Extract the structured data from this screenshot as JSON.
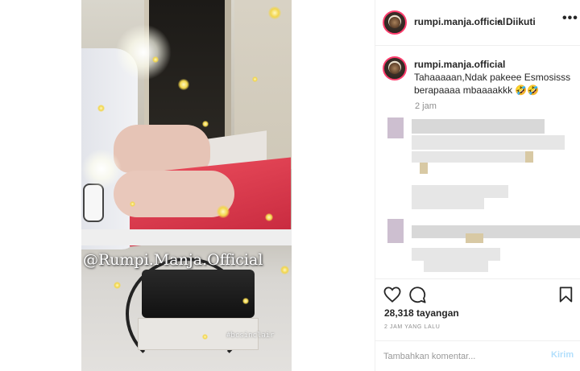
{
  "post": {
    "username": "rumpi.manja.official",
    "separator": "•",
    "follow_status": "Diikuti",
    "more_glyph": "•••"
  },
  "caption": {
    "username": "rumpi.manja.official",
    "text": "Tahaaaaan,Ndak pakeee Esmosisss berapaaaa mbaaaakkk 🤣🤣",
    "time": "2 jam"
  },
  "media": {
    "watermark": "@Rumpi.Manja.Official",
    "tag": "#bcsinclair"
  },
  "stats": {
    "views": "28,318 tayangan",
    "posted_ago": "2 JAM YANG LALU"
  },
  "comment_box": {
    "placeholder": "Tambahkan komentar...",
    "post_label": "Kirim"
  },
  "icons": {
    "like": "heart-icon",
    "comment": "comment-bubble-icon",
    "save": "bookmark-icon"
  },
  "colors": {
    "story_ring": "#ff3d6e",
    "post_disabled": "#b2dffc",
    "text": "#262626",
    "muted": "#8e8e8e"
  }
}
